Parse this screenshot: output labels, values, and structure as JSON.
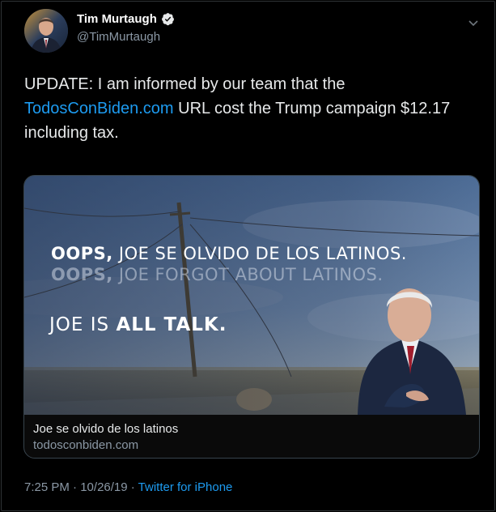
{
  "author": {
    "name": "Tim Murtaugh",
    "handle": "@TimMurtaugh"
  },
  "tweet": {
    "text_before": "UPDATE: I am informed by our team that the ",
    "link_text": "TodosConBiden.com",
    "text_after": " URL cost the Trump campaign $12.17 including tax."
  },
  "card": {
    "image_text": {
      "line1_bold": "OOPS,",
      "line1_rest": " JOE SE OLVIDO DE LOS LATINOS.",
      "line2_bold": "OOPS,",
      "line2_rest": " JOE FORGOT ABOUT LATINOS.",
      "line3_prefix": "JOE IS ",
      "line3_bold": "ALL TALK."
    },
    "title": "Joe se olvido de los latinos",
    "domain": "todosconbiden.com"
  },
  "meta": {
    "time": "7:25 PM",
    "separator": " · ",
    "date": "10/26/19",
    "source": "Twitter for iPhone"
  },
  "icons": {
    "verified": "verified-badge-icon",
    "menu": "chevron-down-icon"
  },
  "colors": {
    "link": "#1d9bf0",
    "background": "#000000",
    "secondary_text": "#8b98a5"
  }
}
